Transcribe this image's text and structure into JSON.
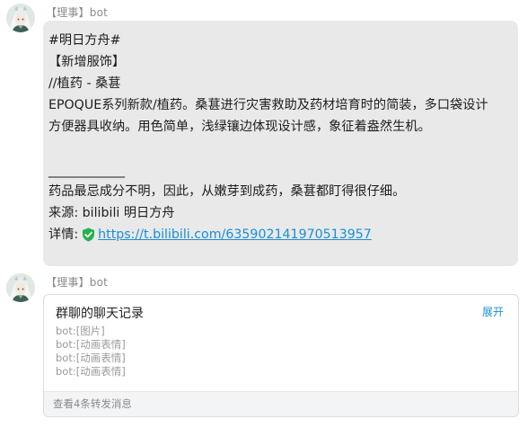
{
  "colors": {
    "bubble": "#e9e9e9",
    "link": "#1a8fd6",
    "muted": "#8a8a8a",
    "verified": "#22b14c"
  },
  "messages": [
    {
      "sender": "【理事】bot",
      "avatar_icon": "white-haired-character-avatar",
      "lines": [
        "#明日方舟#",
        "【新增服饰】",
        "//植药 - 桑葚",
        "EPOQUE系列新款/植药。桑葚进行灾害救助及药材培育时的简装，多口袋设计",
        "方便器具收纳。用色简单，浅绿镶边体现设计感，象征着盎然生机。",
        "",
        "____________",
        "药品最忌成分不明，因此，从嫩芽到成药，桑葚都盯得很仔细。",
        "来源: bilibili 明日方舟"
      ],
      "detail_label": "详情:",
      "detail_icon": "verified-shield-icon",
      "detail_link": "https://t.bilibili.com/635902141970513957"
    },
    {
      "sender": "【理事】bot",
      "avatar_icon": "white-haired-character-avatar",
      "card": {
        "title": "群聊的聊天记录",
        "expand": "展开",
        "lines": [
          "bot:[图片]",
          "bot:[动画表情]",
          "bot:[动画表情]",
          "bot:[动画表情]"
        ],
        "footer": "查看4条转发消息"
      }
    }
  ]
}
